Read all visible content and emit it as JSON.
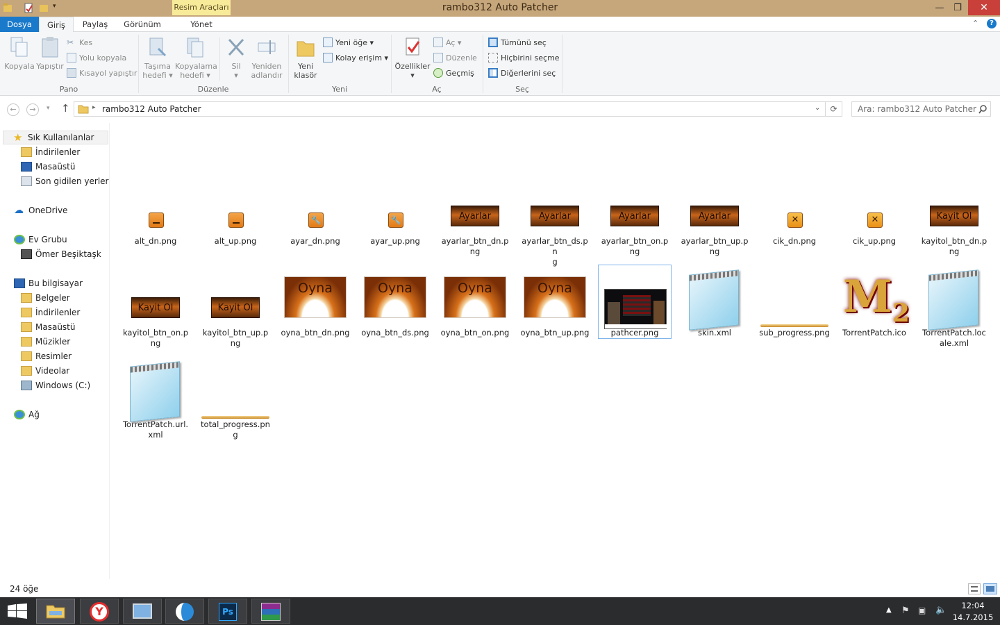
{
  "window": {
    "title": "rambo312 Auto Patcher",
    "context_tab": "Resim Araçları"
  },
  "ribbon_tabs": {
    "file": "Dosya",
    "home": "Giriş",
    "share": "Paylaş",
    "view": "Görünüm",
    "manage": "Yönet"
  },
  "ribbon": {
    "pano": {
      "label": "Pano",
      "copy": "Kopyala",
      "paste": "Yapıştır",
      "cut": "Kes",
      "copy_path": "Yolu kopyala",
      "paste_shortcut": "Kısayol yapıştır"
    },
    "duzenle": {
      "label": "Düzenle",
      "move_to_1": "Taşıma",
      "move_to_2": "hedefi ▾",
      "copy_to_1": "Kopyalama",
      "copy_to_2": "hedefi ▾",
      "delete": "Sil",
      "rename_1": "Yeniden",
      "rename_2": "adlandır"
    },
    "yeni": {
      "label": "Yeni",
      "new_folder_1": "Yeni",
      "new_folder_2": "klasör",
      "new_item": "Yeni öğe ▾",
      "easy_access": "Kolay erişim ▾"
    },
    "ac": {
      "label": "Aç",
      "properties": "Özellikler",
      "open": "Aç ▾",
      "edit": "Düzenle",
      "history": "Geçmiş"
    },
    "sec": {
      "label": "Seç",
      "select_all": "Tümünü seç",
      "select_none": "Hiçbirini seçme",
      "invert": "Diğerlerini seç"
    }
  },
  "address": {
    "path": "rambo312 Auto Patcher",
    "search_placeholder": "Ara: rambo312 Auto Patcher"
  },
  "nav": {
    "quick_access": "Sık Kullanılanlar",
    "downloads": "İndirilenler",
    "desktop": "Masaüstü",
    "recent": "Son gidilen yerler",
    "onedrive": "OneDrive",
    "homegroup": "Ev Grubu",
    "user": "Ömer Beşiktaşk",
    "this_pc": "Bu bilgisayar",
    "documents": "Belgeler",
    "downloads2": "İndirilenler",
    "desktop2": "Masaüstü",
    "music": "Müzikler",
    "pictures": "Resimler",
    "videos": "Videolar",
    "drive_c": "Windows (C:)",
    "network": "Ağ"
  },
  "files": [
    {
      "l1": "alt_dn.png",
      "l2": "",
      "kind": "small-dash"
    },
    {
      "l1": "alt_up.png",
      "l2": "",
      "kind": "small-dash"
    },
    {
      "l1": "ayar_dn.png",
      "l2": "",
      "kind": "small-wrench"
    },
    {
      "l1": "ayar_up.png",
      "l2": "",
      "kind": "small-wrench"
    },
    {
      "l1": "ayarlar_btn_dn.p",
      "l2": "ng",
      "kind": "banner",
      "text": "Ayarlar"
    },
    {
      "l1": "ayarlar_btn_ds.pn",
      "l2": "g",
      "kind": "banner",
      "text": "Ayarlar"
    },
    {
      "l1": "ayarlar_btn_on.p",
      "l2": "ng",
      "kind": "banner",
      "text": "Ayarlar"
    },
    {
      "l1": "ayarlar_btn_up.p",
      "l2": "ng",
      "kind": "banner",
      "text": "Ayarlar"
    },
    {
      "l1": "cik_dn.png",
      "l2": "",
      "kind": "small-x"
    },
    {
      "l1": "cik_up.png",
      "l2": "",
      "kind": "small-x"
    },
    {
      "l1": "kayitol_btn_dn.p",
      "l2": "ng",
      "kind": "banner",
      "text": "Kayit Ol"
    },
    {
      "l1": "kayitol_btn_on.p",
      "l2": "ng",
      "kind": "banner",
      "text": "Kayit Ol"
    },
    {
      "l1": "kayitol_btn_up.p",
      "l2": "ng",
      "kind": "banner",
      "text": "Kayit Ol"
    },
    {
      "l1": "oyna_btn_dn.png",
      "l2": "",
      "kind": "oyna",
      "text": "Oyna"
    },
    {
      "l1": "oyna_btn_ds.png",
      "l2": "",
      "kind": "oyna",
      "text": "Oyna"
    },
    {
      "l1": "oyna_btn_on.png",
      "l2": "",
      "kind": "oyna",
      "text": "Oyna"
    },
    {
      "l1": "oyna_btn_up.png",
      "l2": "",
      "kind": "oyna",
      "text": "Oyna"
    },
    {
      "l1": "pathcer.png",
      "l2": "",
      "kind": "photo"
    },
    {
      "l1": "skin.xml",
      "l2": "",
      "kind": "notepad"
    },
    {
      "l1": "sub_progress.png",
      "l2": "",
      "kind": "bar"
    },
    {
      "l1": "TorrentPatch.ico",
      "l2": "",
      "kind": "m2"
    },
    {
      "l1": "TorrentPatch.loc",
      "l2": "ale.xml",
      "kind": "notepad"
    },
    {
      "l1": "TorrentPatch.url.",
      "l2": "xml",
      "kind": "notepad"
    },
    {
      "l1": "total_progress.pn",
      "l2": "g",
      "kind": "bar"
    }
  ],
  "status": {
    "count": "24 öğe"
  },
  "clock": {
    "time": "12:04",
    "date": "14.7.2015"
  },
  "colors": {
    "titlebar": "#c6a67b",
    "accent": "#1979ca",
    "close": "#c9403a"
  }
}
